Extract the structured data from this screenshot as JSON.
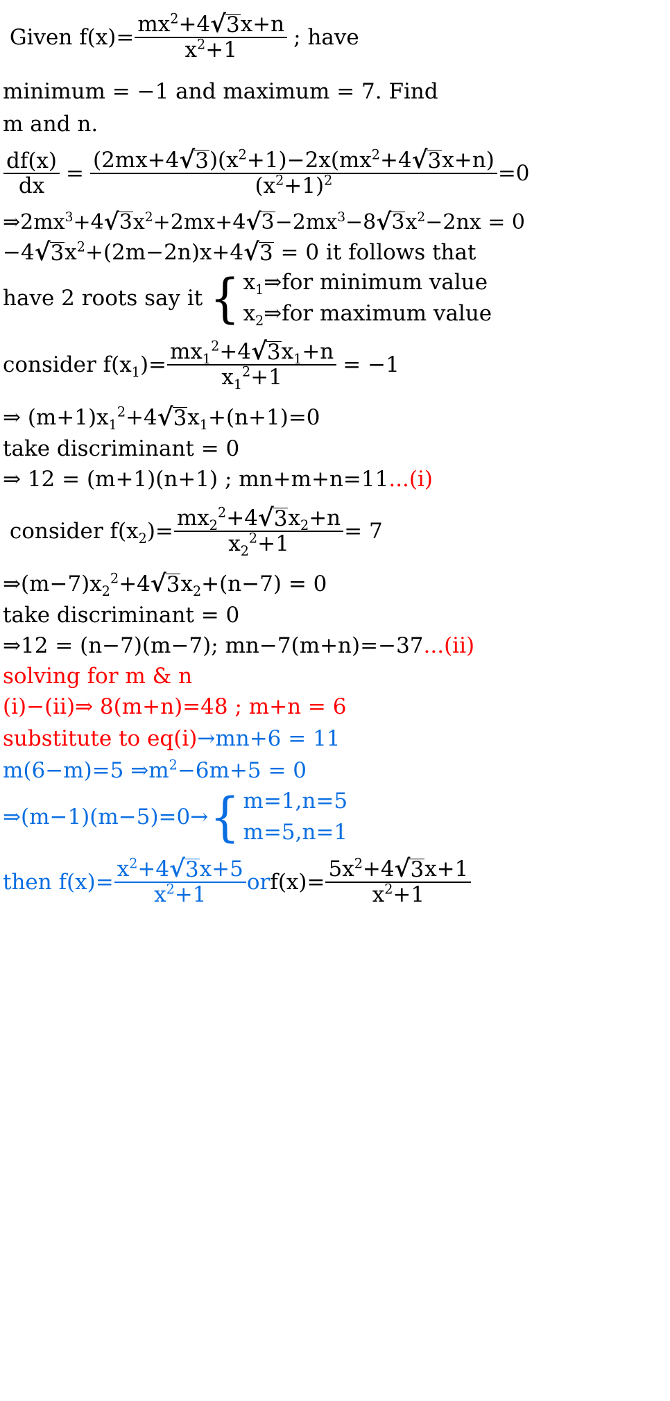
{
  "document": {
    "kind": "math-solution-worksheet",
    "colors": {
      "text": "#000000",
      "red": "#ff0000",
      "blue": "#0a6ee1"
    }
  },
  "problem": {
    "given_prefix": "Given f(x)=",
    "numerator": "mx²+4√3x+n",
    "denominator": "x²+1",
    "given_suffix": "; have",
    "condition_line": "minimum = −1 and maximum = 7. Find",
    "unknowns_line": "m and n."
  },
  "derivative": {
    "lhs_num": "df(x)",
    "lhs_den": "dx",
    "equals": "=",
    "num_part1": "(2mx+4√3)(x²+1)−2x(mx²+4√3x+n)",
    "den_part": "(x²+1)²",
    "result": "=0"
  },
  "expansion": {
    "line1": "⇒2mx³+4√3x²+2mx+4√3−2mx³−8√3x²−2nx = 0",
    "line2": "−4√3x²+(2m−2n)x+4√3 = 0 it follows that"
  },
  "roots": {
    "lead_text": "have 2 roots say it",
    "case1": "x₁⇒for minimum value",
    "case2": "x₂⇒for maximum value"
  },
  "min_case": {
    "label": "consider f(x₁)=",
    "numerator": "mx₁²+4√3x₁+n",
    "denominator": "x₁²+1",
    "equals": "= −1",
    "expanded": "⇒ (m+1)x₁²+4√3x₁+(n+1)=0",
    "discriminant": "take discriminant = 0",
    "result": "⇒ 12 = (m+1)(n+1) ; mn+m+n=11",
    "result_tag": "...(i)"
  },
  "max_case": {
    "label": "consider f(x₂)=",
    "numerator": "mx₂²+4√3x₂+n",
    "denominator": "x₂²+1",
    "equals": "= 7",
    "expanded": "⇒(m−7)x₂²+4√3x₂+(n−7) = 0",
    "discriminant": "take discriminant = 0",
    "result": "⇒12 = (n−7)(m−7); mn−7(m+n)=−37",
    "result_tag": "...(ii)"
  },
  "solving": {
    "heading": "solving for m & n",
    "step1": "(i)−(ii)⇒ 8(m+n)=48 ; m+n = 6",
    "step2_red": "substitute to eq(i) ",
    "step2_blue": "→mn+6 = 11",
    "step3": "m(6−m)=5 ⇒m²−6m+5 = 0",
    "step4_prefix": "⇒(m−1)(m−5)=0→",
    "case_a": "m=1,n=5",
    "case_b": "m=5,n=1"
  },
  "final": {
    "lead": "then f(x)=",
    "first_num": "x²+4√3x+5",
    "first_den": "x²+1",
    "or_text": " or ",
    "second_lead": "f(x)=",
    "second_num": "5x²+4√3x+1",
    "second_den": "x²+1"
  },
  "symbols": {
    "sqrt": "√",
    "implies": "⇒",
    "arrow": "→",
    "minus": "−",
    "plus": "+",
    "equals": "=",
    "brace_open": "{"
  }
}
